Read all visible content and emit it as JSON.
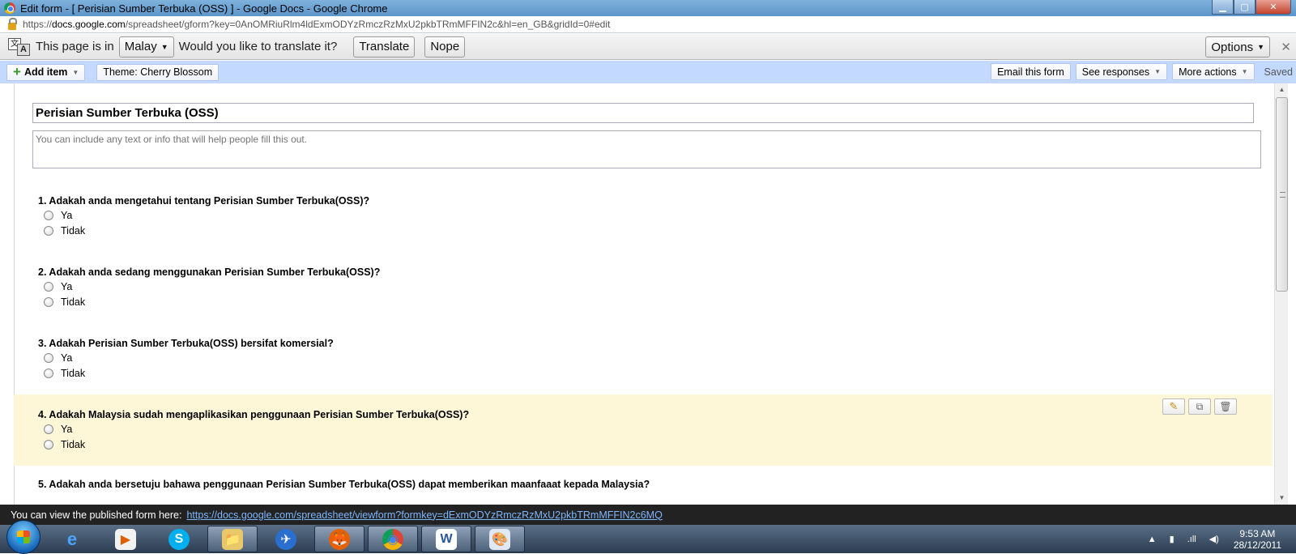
{
  "window": {
    "title": "Edit form - [ Perisian Sumber Terbuka (OSS) ] - Google Docs - Google Chrome",
    "minimize_glyph": "▁",
    "maximize_glyph": "▢",
    "close_glyph": "✕"
  },
  "address_bar": {
    "url_prefix": "https://",
    "domain": "docs.google.com",
    "path": "/spreadsheet/gform?key=0AnOMRiuRlm4ldExmODYzRmczRzMxU2pkbTRmMFFIN2c&hl=en_GB&gridId=0#edit"
  },
  "translate_bar": {
    "icon_a": "文",
    "icon_b": "A",
    "prefix": "This page is in",
    "language": "Malay",
    "question": "Would you like to translate it?",
    "translate_label": "Translate",
    "nope_label": "Nope",
    "options_label": "Options",
    "close_glyph": "✕"
  },
  "toolbar": {
    "add_item_label": "Add item",
    "theme_label": "Theme:  Cherry Blossom",
    "email_label": "Email this form",
    "responses_label": "See responses",
    "more_label": "More actions",
    "saved_label": "Saved"
  },
  "form": {
    "title": "Perisian Sumber Terbuka (OSS)",
    "description_placeholder": "You can include any text or info that will help people fill this out.",
    "questions": [
      {
        "text": "1. Adakah anda mengetahui tentang Perisian Sumber Terbuka(OSS)?",
        "options": [
          "Ya",
          "Tidak"
        ]
      },
      {
        "text": "2. Adakah anda sedang menggunakan Perisian Sumber Terbuka(OSS)?",
        "options": [
          "Ya",
          "Tidak"
        ]
      },
      {
        "text": "3. Adakah Perisian Sumber Terbuka(OSS) bersifat komersial?",
        "options": [
          "Ya",
          "Tidak"
        ]
      },
      {
        "text": "4. Adakah Malaysia sudah mengaplikasikan penggunaan Perisian Sumber Terbuka(OSS)?",
        "options": [
          "Ya",
          "Tidak"
        ]
      },
      {
        "text": "5. Adakah anda bersetuju bahawa penggunaan Perisian Sumber Terbuka(OSS) dapat memberikan maanfaaat kepada Malaysia?",
        "options": []
      }
    ]
  },
  "status_bar": {
    "text": "You can view the published form here:",
    "link": "https://docs.google.com/spreadsheet/viewform?formkey=dExmODYzRmczRzMxU2pkbTRmMFFIN2c6MQ"
  },
  "taskbar": {
    "apps": [
      "e",
      "▶",
      "S",
      "📁",
      "✈",
      "🦊",
      "◉",
      "W",
      "🎨"
    ],
    "tray_up": "▲",
    "tray_signal": ".ıll",
    "tray_volume": "◀)",
    "time": "9:53 AM",
    "date": "28/12/2011"
  }
}
